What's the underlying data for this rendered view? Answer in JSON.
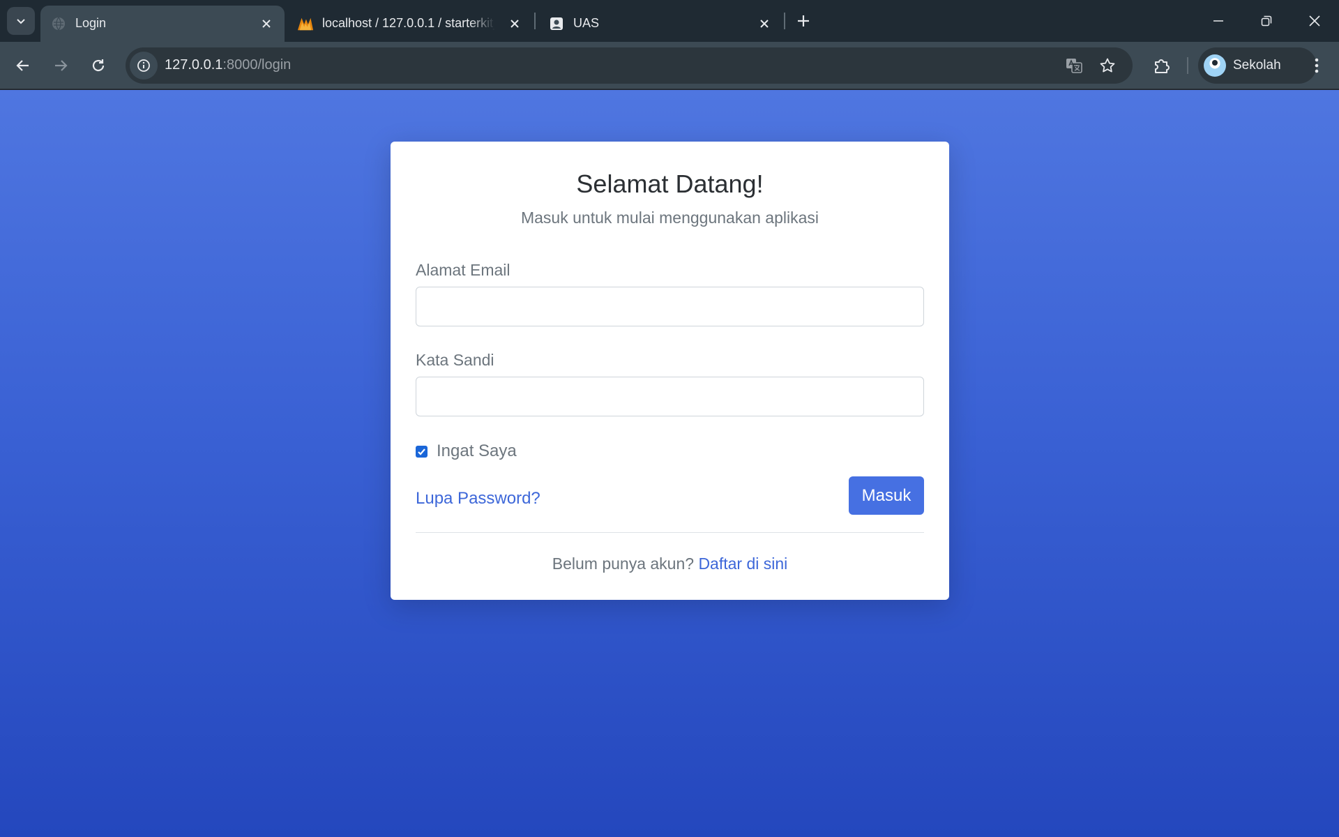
{
  "browser": {
    "tabs": [
      {
        "title": "Login",
        "favicon": "globe-icon",
        "active": true
      },
      {
        "title": "localhost / 127.0.0.1 / starterkit_",
        "favicon": "phpmyadmin-icon",
        "active": false
      },
      {
        "title": "UAS",
        "favicon": "contact-icon",
        "active": false
      }
    ],
    "address": {
      "host": "127.0.0.1",
      "path": ":8000/login"
    },
    "profile_name": "Sekolah"
  },
  "login": {
    "title": "Selamat Datang!",
    "subtitle": "Masuk untuk mulai menggunakan aplikasi",
    "email_label": "Alamat Email",
    "email_value": "",
    "password_label": "Kata Sandi",
    "password_value": "",
    "remember_label": "Ingat Saya",
    "remember_checked": true,
    "forgot_label": "Lupa Password?",
    "submit_label": "Masuk",
    "register_prompt": "Belum punya akun?",
    "register_link": "Daftar di sini"
  },
  "colors": {
    "accent": "#4670e2",
    "link": "#3d67d9",
    "background_top": "#4f76e0",
    "background_bottom": "#2447bd"
  }
}
